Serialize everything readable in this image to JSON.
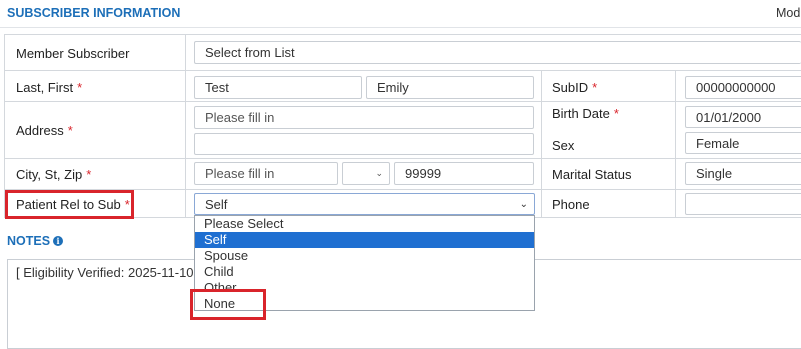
{
  "section": {
    "title": "SUBSCRIBER INFORMATION",
    "mode_text": "Mod"
  },
  "rows": {
    "member_subscriber": {
      "label": "Member Subscriber",
      "value": "Select from List"
    },
    "last_first": {
      "label": "Last, First",
      "last": "Test",
      "first": "Emily"
    },
    "address": {
      "label": "Address",
      "line1_placeholder": "Please fill in",
      "line2": ""
    },
    "city_st_zip": {
      "label": "City, St, Zip",
      "city_placeholder": "Please fill in",
      "state": "",
      "zip": "99999"
    },
    "patient_rel": {
      "label": "Patient Rel to Sub",
      "value": "Self"
    },
    "subid": {
      "label": "SubID",
      "value": "00000000000"
    },
    "birth_date": {
      "label": "Birth Date",
      "value": "01/01/2000"
    },
    "sex": {
      "label": "Sex",
      "value": "Female"
    },
    "marital_status": {
      "label": "Marital Status",
      "value": "Single"
    },
    "phone": {
      "label": "Phone",
      "value": ""
    }
  },
  "required_mark": "*",
  "dropdown": {
    "options": [
      "Please Select",
      "Self",
      "Spouse",
      "Child",
      "Other",
      "None"
    ],
    "selected": "Self"
  },
  "notes": {
    "title": "NOTES",
    "text": "[ Eligibility Verified: 2025-11-10"
  },
  "colors": {
    "accent": "#1d6fb8",
    "highlight": "#d9242b",
    "selected_option": "#1f6fd1"
  }
}
